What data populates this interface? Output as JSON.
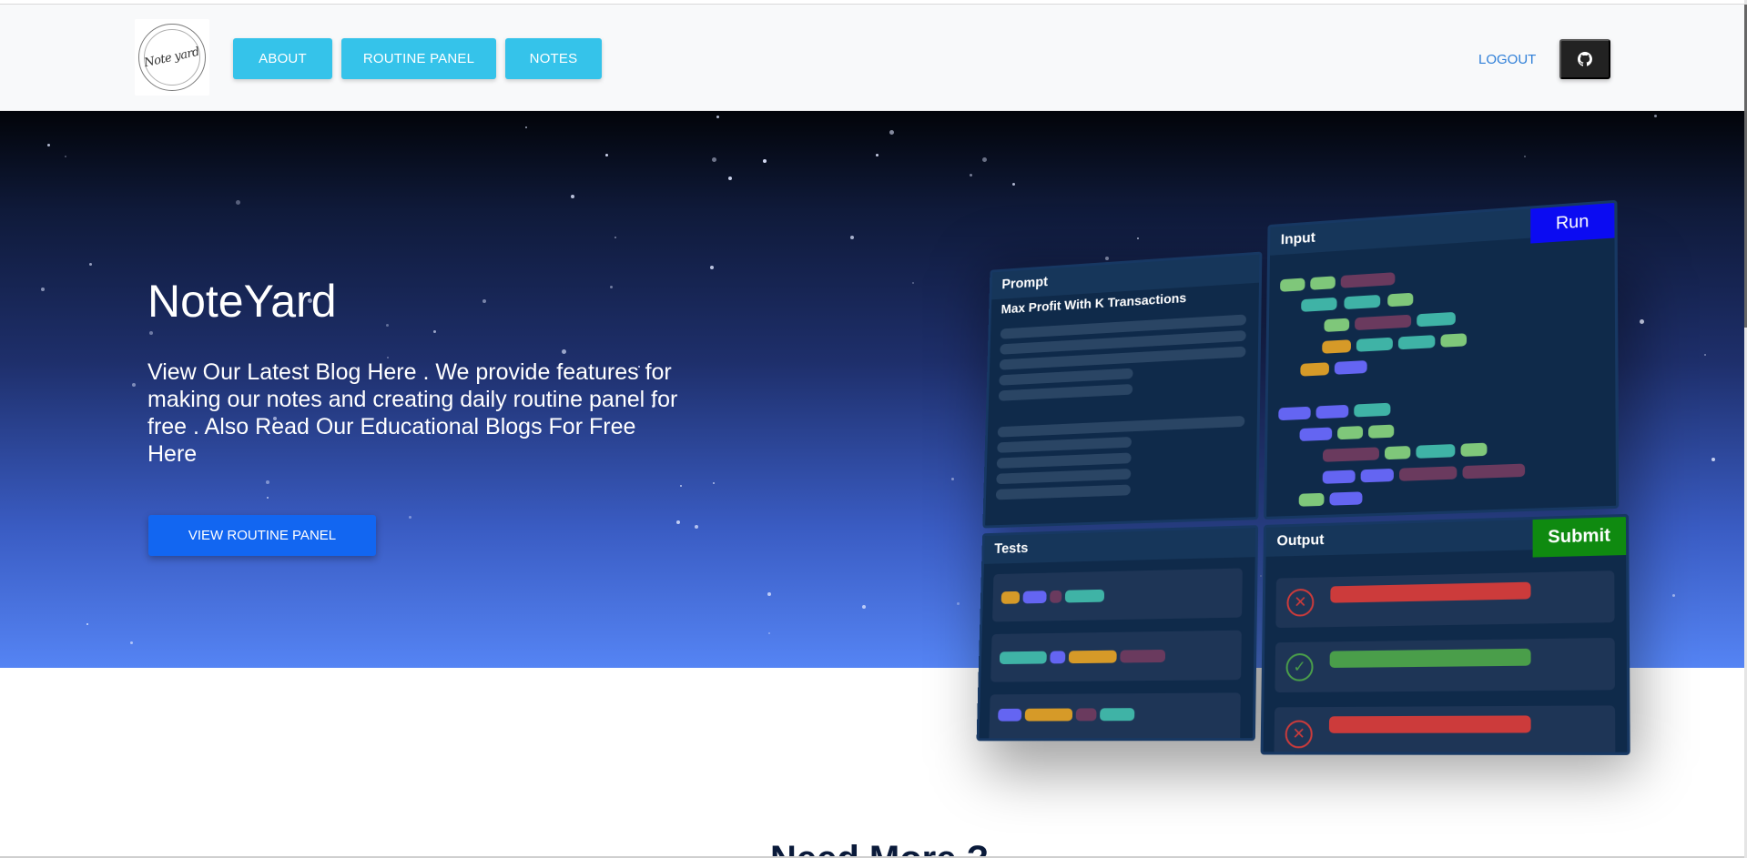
{
  "navbar": {
    "logo_alt": "Note yard",
    "items": [
      {
        "label": "ABOUT"
      },
      {
        "label": "ROUTINE PANEL"
      },
      {
        "label": "NOTES"
      }
    ],
    "logout_label": "LOGOUT",
    "github_icon": "github-icon"
  },
  "hero": {
    "title": "NoteYard",
    "description": "View Our Latest Blog Here . We provide features for making our notes and creating daily routine panel for free . Also Read Our Educational Blogs For Free Here",
    "cta_label": "VIEW ROUTINE PANEL"
  },
  "illustration": {
    "prompt_header": "Prompt",
    "prompt_title": "Max Profit With K Transactions",
    "input_header": "Input",
    "run_label": "Run",
    "tests_header": "Tests",
    "output_header": "Output",
    "submit_label": "Submit"
  },
  "section": {
    "heading": "Need More ?"
  },
  "colors": {
    "nav_button": "#35c3ea",
    "cta_button": "#1266f1",
    "link": "#2f7fd8",
    "run": "#0b0bf2",
    "submit": "#0f8a10"
  }
}
